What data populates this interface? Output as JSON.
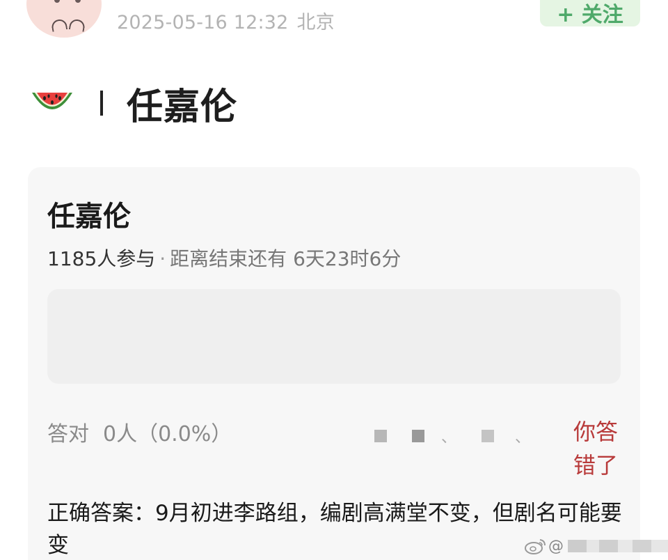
{
  "post": {
    "timestamp": "2025-05-16 12:32",
    "location": "北京",
    "follow_label": "+ 关注"
  },
  "topic": {
    "icon": "watermelon-icon",
    "title": "任嘉伦"
  },
  "quiz": {
    "title": "任嘉伦",
    "participants": "1185人参与",
    "separator": "·",
    "remaining": "距离结束还有 6天23时6分",
    "correct_label": "答对",
    "correct_count": "0人（0.0%）",
    "result_label": "你答错了",
    "answer": "正确答案：9月初进李路组，编剧高满堂不变，但剧名可能要变"
  },
  "watermark": {
    "prefix": "@"
  },
  "colors": {
    "follow_bg": "#e5f5e3",
    "follow_text": "#4fa96a",
    "wrong_text": "#b83a3a",
    "card_bg": "#f7f7f7"
  }
}
